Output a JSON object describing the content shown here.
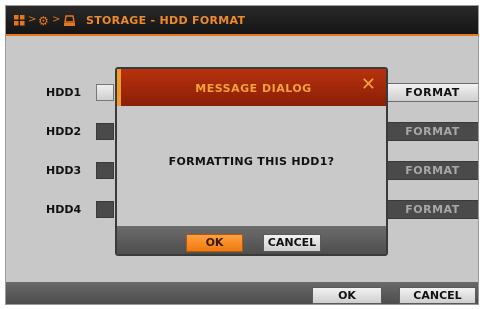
{
  "header": {
    "title": "STORAGE - HDD FORMAT",
    "icons": [
      "grid-icon",
      "gear-icon",
      "storage-icon"
    ],
    "accent": "#e8761c"
  },
  "rows": [
    {
      "label": "HDD1",
      "button": "FORMAT"
    },
    {
      "label": "HDD2",
      "button": "FORMAT"
    },
    {
      "label": "HDD3",
      "button": "FORMAT"
    },
    {
      "label": "HDD4",
      "button": "FORMAT"
    }
  ],
  "footer": {
    "ok": "OK",
    "cancel": "CANCEL"
  },
  "dialog": {
    "title": "MESSAGE DIALOG",
    "close": "✕",
    "message": "FORMATTING THIS HDD1?",
    "ok": "OK",
    "cancel": "CANCEL",
    "header_color": "#a4280a",
    "ok_color": "#f58a20"
  }
}
